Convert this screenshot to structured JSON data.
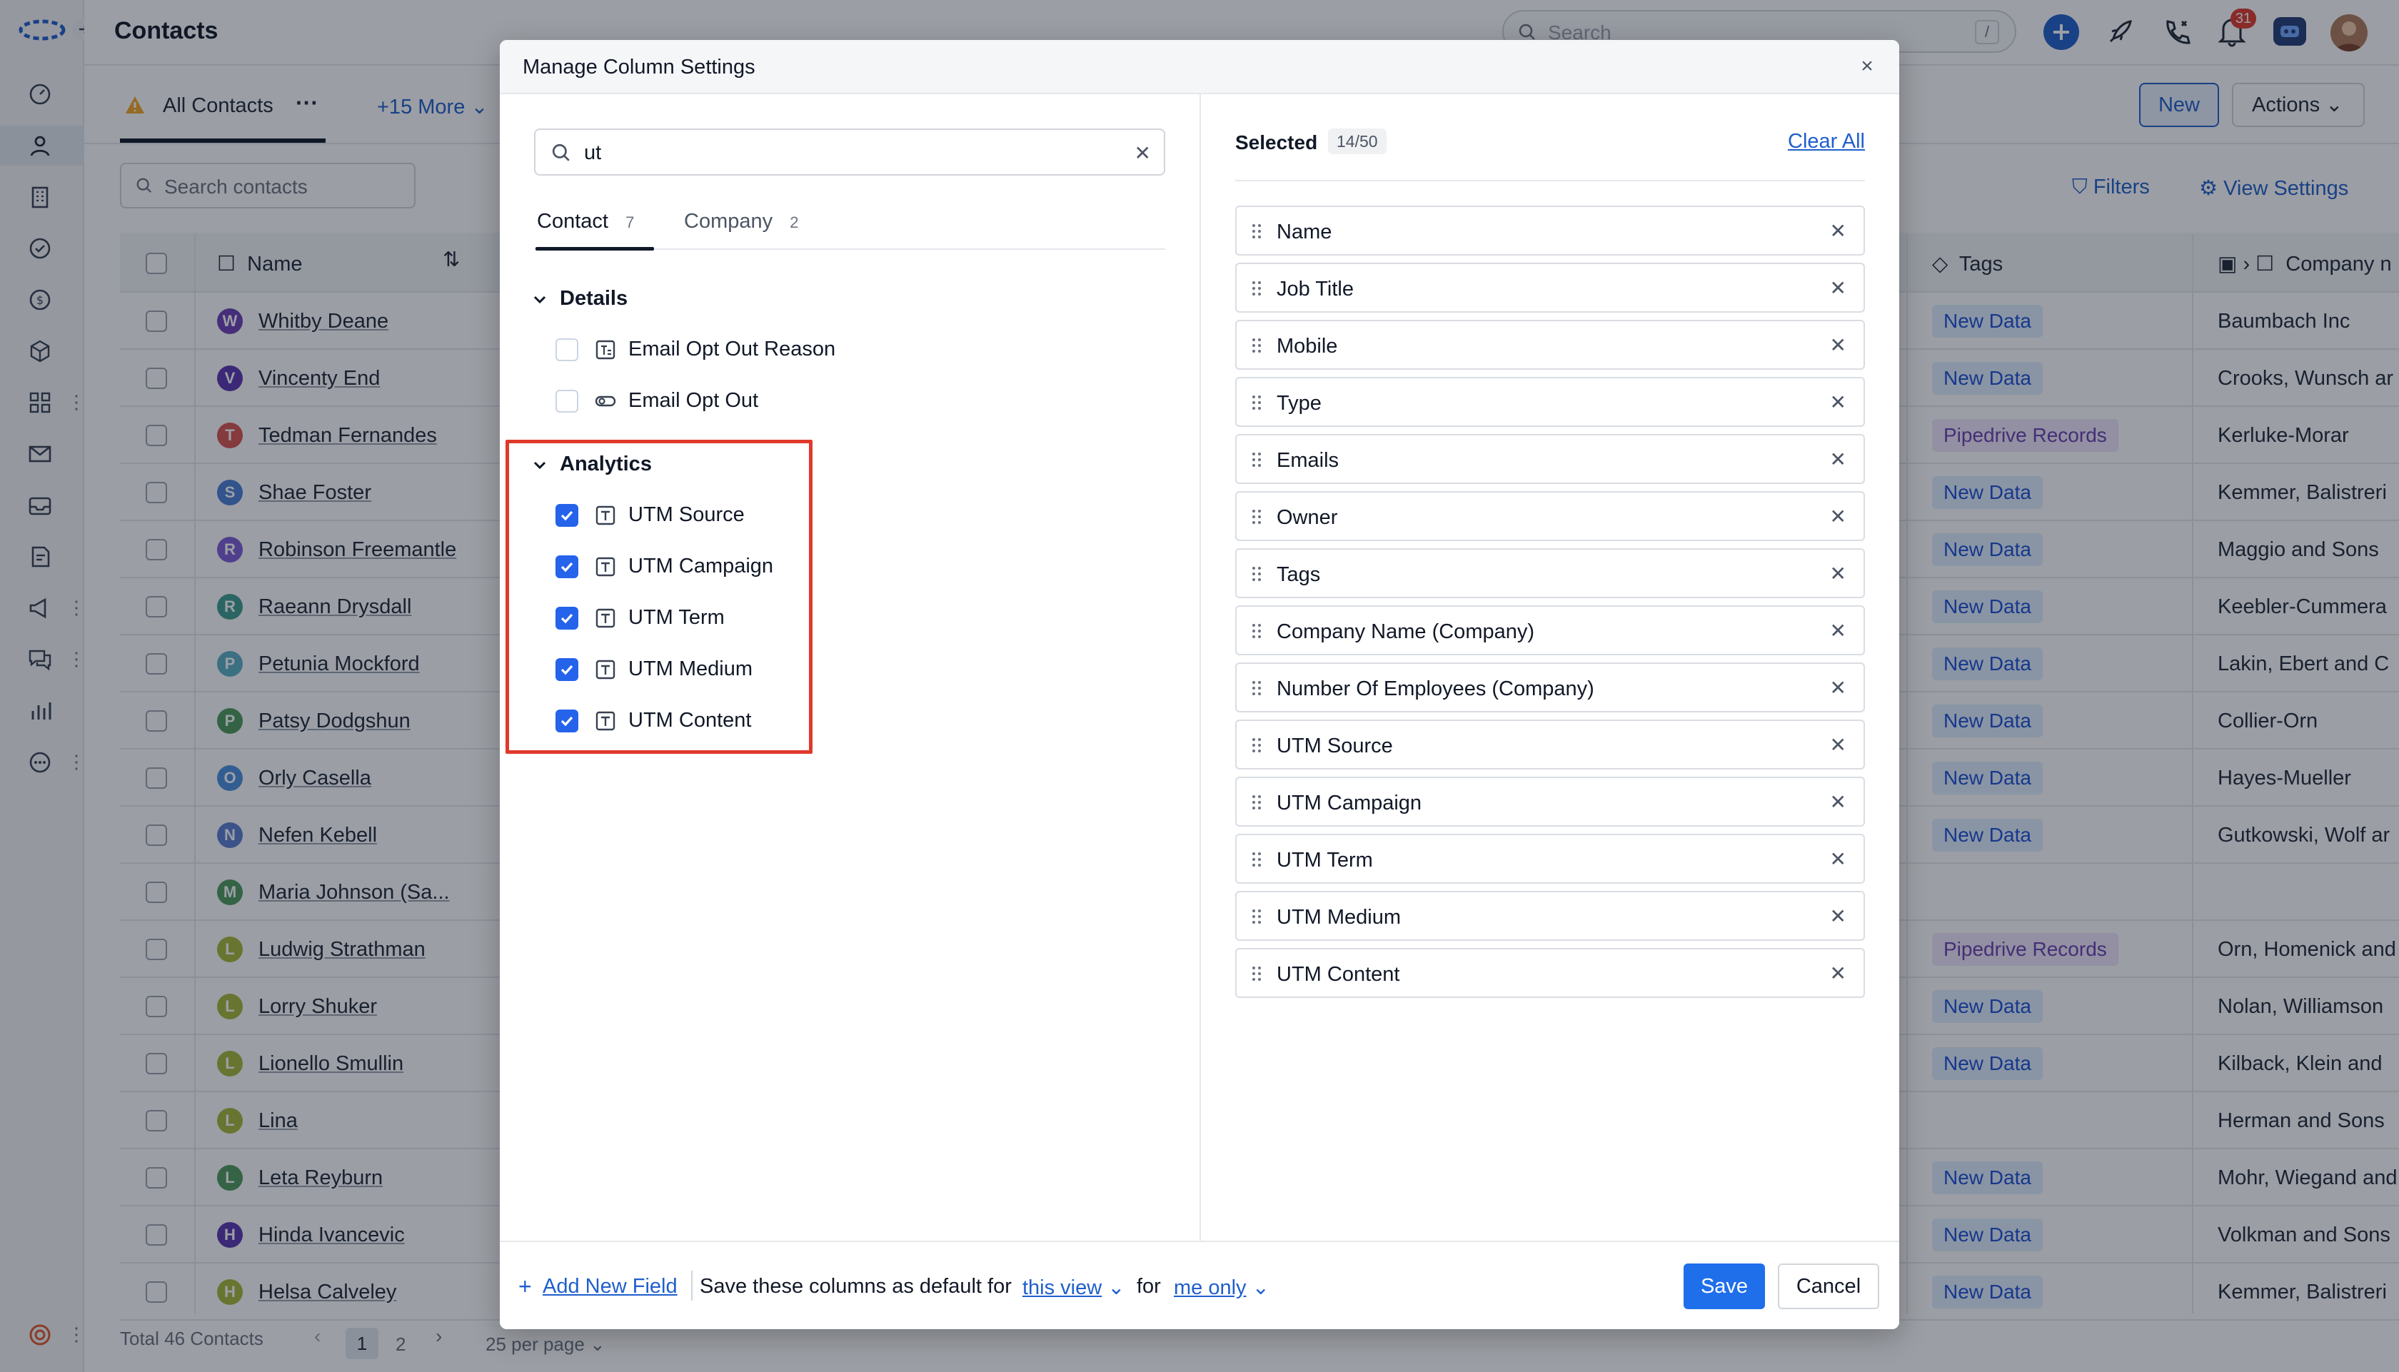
{
  "app": {
    "page_title": "Contacts",
    "search_placeholder": "Search",
    "search_shortcut": "/",
    "notification_count": "31"
  },
  "contacts_view": {
    "view_tab": "All Contacts",
    "more_views": "+15 More",
    "new_button": "New",
    "actions_button": "Actions",
    "search_placeholder": "Search contacts",
    "filters": "Filters",
    "view_settings": "View Settings",
    "columns": {
      "name": "Name",
      "tags": "Tags",
      "company": "Company n"
    },
    "rows": [
      {
        "initial": "W",
        "color": "#6d3fb8",
        "name": "Whitby Deane",
        "tag": "New Data",
        "tag_kind": "blue",
        "company": "Baumbach Inc"
      },
      {
        "initial": "V",
        "color": "#5b35b0",
        "name": "Vincenty End",
        "tag": "New Data",
        "tag_kind": "blue",
        "company": "Crooks, Wunsch ar"
      },
      {
        "initial": "T",
        "color": "#d9534f",
        "name": "Tedman Fernandes",
        "tag": "Pipedrive Records",
        "tag_kind": "purple",
        "company": "Kerluke-Morar"
      },
      {
        "initial": "S",
        "color": "#4a7fd6",
        "name": "Shae Foster",
        "tag": "New Data",
        "tag_kind": "blue",
        "company": "Kemmer, Balistreri"
      },
      {
        "initial": "R",
        "color": "#7c5cd6",
        "name": "Robinson Freemantle",
        "tag": "New Data",
        "tag_kind": "blue",
        "company": "Maggio and Sons"
      },
      {
        "initial": "R",
        "color": "#3f9e8f",
        "name": "Raeann Drysdall",
        "tag": "New Data",
        "tag_kind": "blue",
        "company": "Keebler-Cummera"
      },
      {
        "initial": "P",
        "color": "#5bb0c6",
        "name": "Petunia Mockford",
        "tag": "New Data",
        "tag_kind": "blue",
        "company": "Lakin, Ebert and C"
      },
      {
        "initial": "P",
        "color": "#4c9a5a",
        "name": "Patsy Dodgshun",
        "tag": "New Data",
        "tag_kind": "blue",
        "company": "Collier-Orn"
      },
      {
        "initial": "O",
        "color": "#4a8fe0",
        "name": "Orly Casella",
        "tag": "New Data",
        "tag_kind": "blue",
        "company": "Hayes-Mueller"
      },
      {
        "initial": "N",
        "color": "#5a7fd0",
        "name": "Nefen Kebell",
        "tag": "New Data",
        "tag_kind": "blue",
        "company": "Gutkowski, Wolf ar"
      },
      {
        "initial": "M",
        "color": "#4e9a5e",
        "name": "Maria Johnson (Sa...",
        "tag": "",
        "tag_kind": "none",
        "company": ""
      },
      {
        "initial": "L",
        "color": "#a8b93a",
        "name": "Ludwig Strathman",
        "tag": "Pipedrive Records",
        "tag_kind": "purple",
        "company": "Orn, Homenick and"
      },
      {
        "initial": "L",
        "color": "#a8b93a",
        "name": "Lorry Shuker",
        "tag": "New Data",
        "tag_kind": "blue",
        "company": "Nolan, Williamson"
      },
      {
        "initial": "L",
        "color": "#a8b93a",
        "name": "Lionello Smullin",
        "tag": "New Data",
        "tag_kind": "blue",
        "company": "Kilback, Klein and"
      },
      {
        "initial": "L",
        "color": "#a8b93a",
        "name": "Lina",
        "tag": "",
        "tag_kind": "none",
        "company": "Herman and Sons"
      },
      {
        "initial": "L",
        "color": "#4e9a5e",
        "name": "Leta Reyburn",
        "tag": "New Data",
        "tag_kind": "blue",
        "company": "Mohr, Wiegand and"
      },
      {
        "initial": "H",
        "color": "#5b35b0",
        "name": "Hinda Ivancevic",
        "tag": "New Data",
        "tag_kind": "blue",
        "company": "Volkman and Sons"
      },
      {
        "initial": "H",
        "color": "#a8b93a",
        "name": "Helsa Calveley",
        "tag": "New Data",
        "tag_kind": "blue",
        "company": "Kemmer, Balistreri"
      }
    ],
    "footer": {
      "total": "Total 46 Contacts",
      "page1": "1",
      "page2": "2",
      "per_page": "25 per page"
    }
  },
  "modal": {
    "title": "Manage Column Settings",
    "close": "×",
    "search_value": "ut",
    "tabs": [
      {
        "label": "Contact",
        "count": "7"
      },
      {
        "label": "Company",
        "count": "2"
      }
    ],
    "sections": [
      {
        "title": "Details",
        "fields": [
          {
            "label": "Email Opt Out Reason",
            "checked": false,
            "type_icon": "text-area-icon"
          },
          {
            "label": "Email Opt Out",
            "checked": false,
            "type_icon": "toggle-icon"
          }
        ]
      },
      {
        "title": "Analytics",
        "fields": [
          {
            "label": "UTM Source",
            "checked": true,
            "type_icon": "text-icon"
          },
          {
            "label": "UTM Campaign",
            "checked": true,
            "type_icon": "text-icon"
          },
          {
            "label": "UTM Term",
            "checked": true,
            "type_icon": "text-icon"
          },
          {
            "label": "UTM Medium",
            "checked": true,
            "type_icon": "text-icon"
          },
          {
            "label": "UTM Content",
            "checked": true,
            "type_icon": "text-icon"
          }
        ]
      }
    ],
    "selected_title": "Selected",
    "selected_count": "14/50",
    "clear_all": "Clear All",
    "selected": [
      "Name",
      "Job Title",
      "Mobile",
      "Type",
      "Emails",
      "Owner",
      "Tags",
      "Company Name (Company)",
      "Number Of Employees (Company)",
      "UTM Source",
      "UTM Campaign",
      "UTM Term",
      "UTM Medium",
      "UTM Content"
    ],
    "footer": {
      "add_field": "Add New Field",
      "save_text": "Save these columns as default for",
      "scope": "this view",
      "for_text": "for",
      "audience": "me only",
      "save": "Save",
      "cancel": "Cancel"
    }
  },
  "colors": {
    "accent": "#1f6feb",
    "highlight": "#e0392b",
    "checkbox": "#2563eb"
  }
}
